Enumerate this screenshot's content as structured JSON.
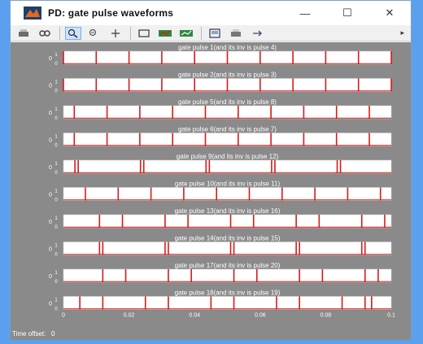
{
  "window": {
    "title": "PD: gate pulse waveforms",
    "controls": {
      "minimize": "—",
      "maximize": "☐",
      "close": "✕"
    }
  },
  "toolbar": {
    "icons": [
      "print-icon",
      "link-icon",
      "zoom-in-icon",
      "zoom-out-icon",
      "pan-icon",
      "fit-icon",
      "save-icon",
      "copy-icon",
      "config-icon",
      "export-icon",
      "print-figure-icon",
      "hook-icon"
    ]
  },
  "footer": {
    "time_offset_label": "Time offset:",
    "time_offset_value": "0"
  },
  "colors": {
    "trace": "#d81a1a",
    "plot_bg": "#ffffff",
    "frame_bg": "#8a8a8a"
  },
  "chart_data": {
    "type": "line",
    "xlim": [
      0,
      0.1
    ],
    "x_ticks": [
      "0",
      "0.02",
      "0.04",
      "0.06",
      "0.08",
      "0.1"
    ],
    "y_ticks": [
      "0",
      "1"
    ],
    "panels": [
      {
        "title": "gate pulse 1(and its inv is pulse 4)",
        "edges": [
          0.0,
          0.01,
          0.02,
          0.03,
          0.04,
          0.05,
          0.06,
          0.07,
          0.08,
          0.09,
          0.1
        ]
      },
      {
        "title": "gate pulse 2(and its inv is pulse 3)",
        "edges": [
          0.0,
          0.01,
          0.02,
          0.03,
          0.04,
          0.05,
          0.06,
          0.07,
          0.08,
          0.09,
          0.1
        ]
      },
      {
        "title": "gate pulse 5(and its inv is pulse 8)",
        "edges": [
          0.0033,
          0.0133,
          0.0233,
          0.0333,
          0.0433,
          0.0533,
          0.0633,
          0.0733,
          0.0833,
          0.0933
        ]
      },
      {
        "title": "gate pulse 6(and its inv is pulse 7)",
        "edges": [
          0.0033,
          0.0133,
          0.0233,
          0.0333,
          0.0433,
          0.0533,
          0.0633,
          0.0733,
          0.0833,
          0.0933
        ]
      },
      {
        "title": "gate pulse 9(and its inv is pulse 12)",
        "edges": [
          0.0035,
          0.0045,
          0.0235,
          0.0245,
          0.0435,
          0.0445,
          0.0635,
          0.0645,
          0.0835,
          0.0845
        ]
      },
      {
        "title": "gate pulse 10(and its inv is pulse 11)",
        "edges": [
          0.0067,
          0.0167,
          0.0267,
          0.0367,
          0.0467,
          0.0567,
          0.0667,
          0.0767,
          0.0867,
          0.0967
        ]
      },
      {
        "title": "gate pulse 13(and its inv is pulse 16)",
        "edges": [
          0.011,
          0.018,
          0.031,
          0.038,
          0.051,
          0.058,
          0.071,
          0.078,
          0.091,
          0.098
        ]
      },
      {
        "title": "gate pulse 14(and its inv is pulse 15)",
        "edges": [
          0.011,
          0.012,
          0.031,
          0.032,
          0.051,
          0.052,
          0.071,
          0.072,
          0.091,
          0.092
        ]
      },
      {
        "title": "gate pulse 17(and its inv is pulse 20)",
        "edges": [
          0.012,
          0.019,
          0.032,
          0.039,
          0.052,
          0.059,
          0.072,
          0.079,
          0.092,
          0.096
        ]
      },
      {
        "title": "gate pulse 18(and its inv is pulse 19)",
        "edges": [
          0.005,
          0.012,
          0.025,
          0.032,
          0.045,
          0.052,
          0.065,
          0.072,
          0.085,
          0.092,
          0.094
        ]
      }
    ]
  }
}
